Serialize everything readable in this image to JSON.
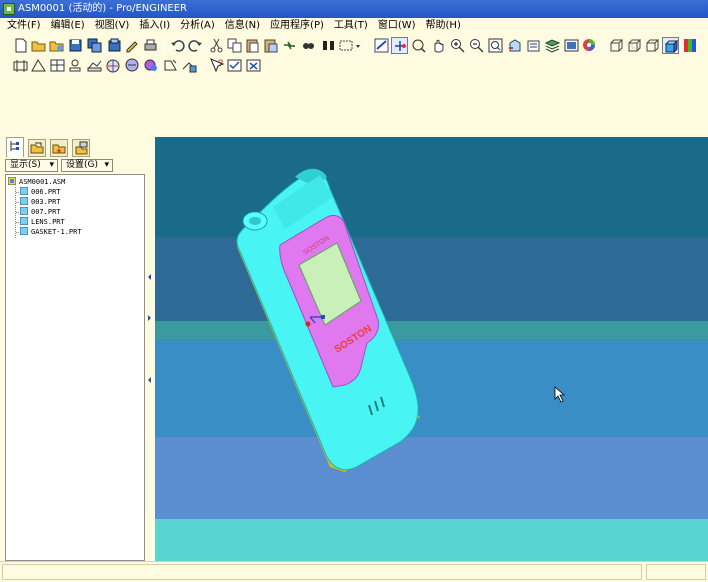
{
  "window": {
    "title": "ASM0001 (活动的) - Pro/ENGINEER"
  },
  "menubar": {
    "items": [
      "文件(F)",
      "编辑(E)",
      "视图(V)",
      "插入(I)",
      "分析(A)",
      "信息(N)",
      "应用程序(P)",
      "工具(T)",
      "窗口(W)",
      "帮助(H)"
    ]
  },
  "toolbar1": {
    "icons": [
      "new-icon",
      "open-icon",
      "open-folder-icon",
      "save-icon",
      "save-copy-icon",
      "backup-icon",
      "rename-icon",
      "print-icon",
      "undo-icon",
      "redo-icon",
      "cut-icon",
      "copy-icon",
      "paste-icon",
      "paste-special-icon",
      "regenerate-icon",
      "find-icon",
      "selection-box-icon",
      "repaint-icon",
      "spin-center-icon",
      "orient-mode-icon",
      "zoom-in-icon",
      "zoom-out-icon",
      "refit-icon",
      "reorient-icon",
      "saved-views-icon",
      "layers-icon",
      "view-manager-icon",
      "appearance-icon",
      "wireframe-icon",
      "hidden-line-icon",
      "no-hidden-icon",
      "shading-icon",
      "enhanced-realism-icon"
    ]
  },
  "toolbar2": {
    "icons": [
      "datum-planes-icon",
      "datum-axes-icon",
      "point-display-icon",
      "csys-display-icon",
      "spin-display-icon",
      "annotation-display-icon",
      "model-analysis-icon",
      "material-icon",
      "context-help-icon",
      "checkbox-icon",
      "close-window-icon"
    ]
  },
  "navigator": {
    "tabs": [
      "model-tree-tab",
      "folder-browser-tab",
      "favorites-tab",
      "connections-tab"
    ],
    "show_label": "显示(S)",
    "settings_label": "设置(G)",
    "tree": {
      "root": "ASM0001.ASM",
      "children": [
        "006.PRT",
        "003.PRT",
        "007.PRT",
        "LENS.PRT",
        "GASKET-1.PRT"
      ]
    }
  },
  "viewport": {
    "background_bands": [
      "#1a6a8a",
      "#2e6a96",
      "#3a9a9e",
      "#3a8ec6",
      "#5a8ed0",
      "#5ad4d0"
    ],
    "model_colors": {
      "body": "#48f4f4",
      "shadow_edge": "#c8c020",
      "screen_frame": "#e078f0",
      "screen": "#c8f0b8",
      "logo_text": "#e84030"
    },
    "logo_text": "SOSTON"
  },
  "colors": {
    "background": "#fefbe0",
    "titlebar": "#2256c8"
  }
}
